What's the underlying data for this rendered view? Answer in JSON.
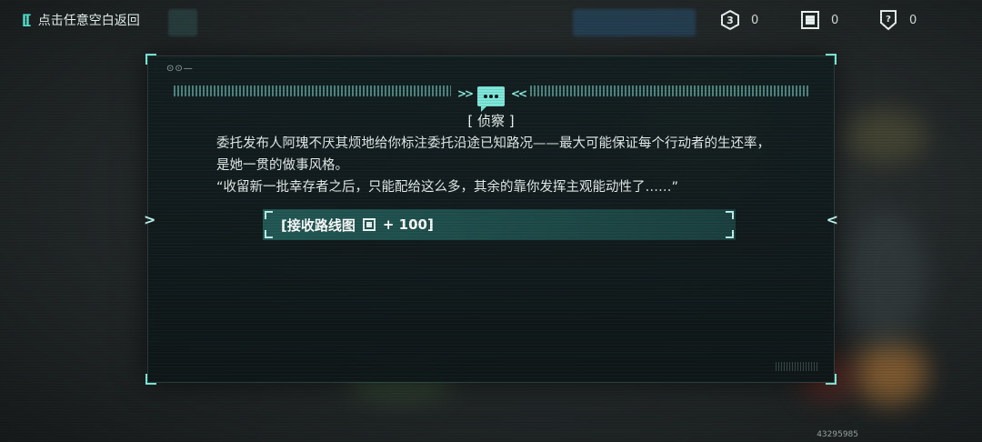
{
  "top_bar": {
    "back_label": "点击任意空白返回",
    "resources": [
      {
        "icon": "b-token-icon",
        "value": "0"
      },
      {
        "icon": "route-map-icon",
        "value": "0"
      },
      {
        "icon": "question-badge-icon",
        "value": "0"
      }
    ]
  },
  "dialog": {
    "title": "[ 侦察 ]",
    "paragraph_1": "委托发布人阿瑰不厌其烦地给你标注委托沿途已知路况——最大可能保证每个行动者的生还率，是她一贯的做事风格。",
    "paragraph_2": "“收留新一批幸存者之后，只能配给这么多，其余的靠你发挥主观能动性了……”",
    "reward": {
      "prefix": "[接收路线图",
      "icon": "route-map-icon",
      "suffix": "+ 100]"
    }
  },
  "footer_id": "43295985",
  "colors": {
    "accent": "#7ee8da",
    "reward_bar": "#2f6e6a",
    "panel": "#121d1f"
  }
}
